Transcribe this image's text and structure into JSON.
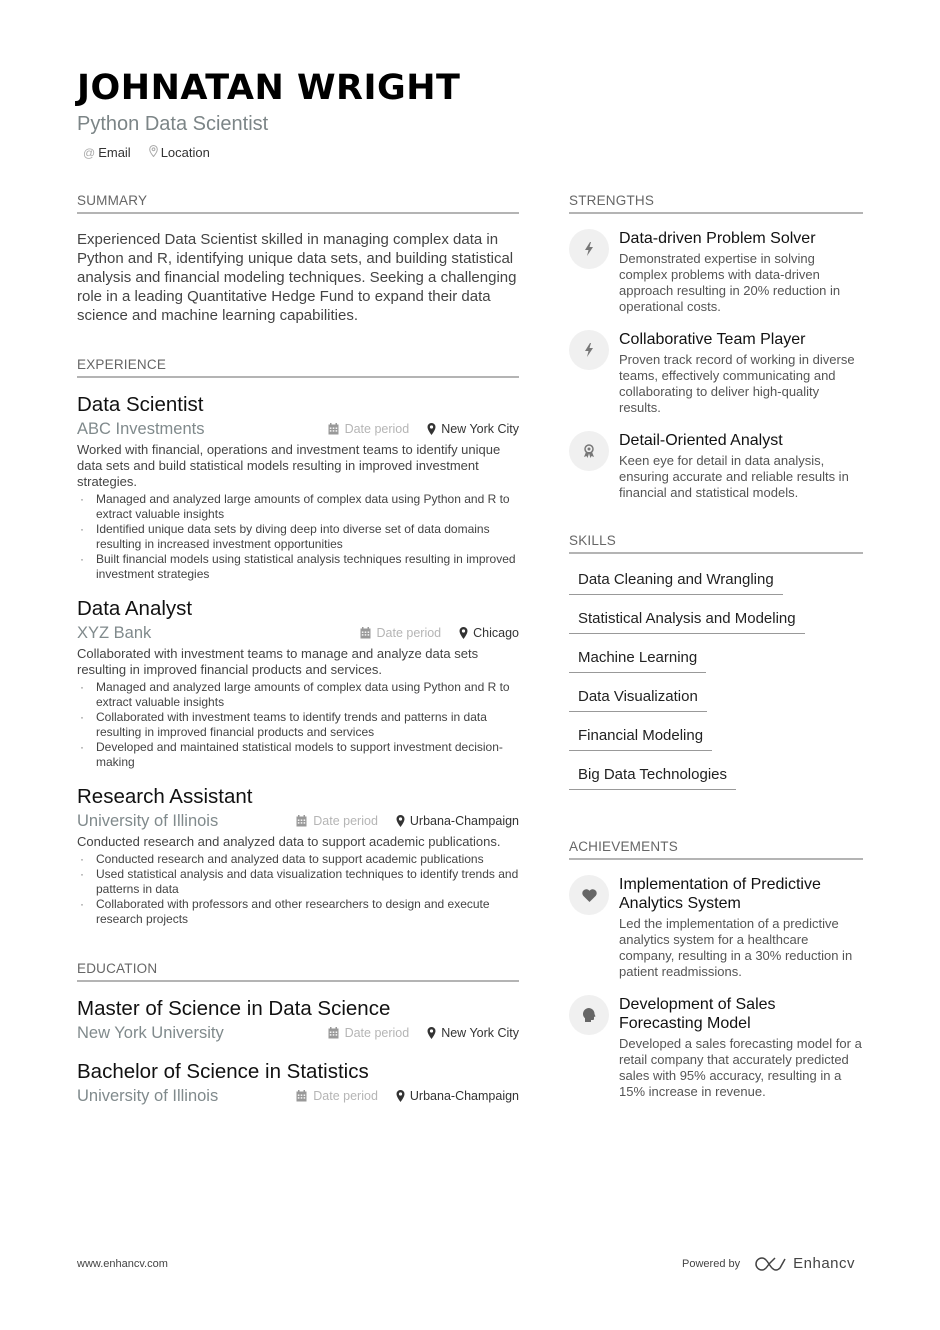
{
  "header": {
    "name": "JOHNATAN WRIGHT",
    "title": "Python Data Scientist",
    "contacts": [
      {
        "icon": "at-icon",
        "label": "Email"
      },
      {
        "icon": "location-pin-icon",
        "label": "Location"
      }
    ]
  },
  "summary": {
    "heading": "SUMMARY",
    "text": "Experienced Data Scientist skilled in managing complex data in Python and R, identifying unique data sets, and building statistical analysis and financial modeling techniques. Seeking a challenging role in a leading Quantitative Hedge Fund to expand their data science and machine learning capabilities."
  },
  "experience": {
    "heading": "EXPERIENCE",
    "items": [
      {
        "role": "Data Scientist",
        "company": "ABC Investments",
        "date": "Date period",
        "location": "New York City",
        "description": "Worked with financial, operations and investment teams to identify unique data sets and build statistical models resulting in improved investment strategies.",
        "bullets": [
          "Managed and analyzed large amounts of complex data using Python and R to extract valuable insights",
          "Identified unique data sets by diving deep into diverse set of data domains resulting in increased investment opportunities",
          "Built financial models using statistical analysis techniques resulting in improved investment strategies"
        ]
      },
      {
        "role": "Data Analyst",
        "company": "XYZ Bank",
        "date": "Date period",
        "location": "Chicago",
        "description": "Collaborated with investment teams to manage and analyze data sets resulting in improved financial products and services.",
        "bullets": [
          "Managed and analyzed large amounts of complex data using Python and R to extract valuable insights",
          "Collaborated with investment teams to identify trends and patterns in data resulting in improved financial products and services",
          "Developed and maintained statistical models to support investment decision-making"
        ]
      },
      {
        "role": "Research Assistant",
        "company": "University of Illinois",
        "date": "Date period",
        "location": "Urbana-Champaign",
        "description": "Conducted research and analyzed data to support academic publications.",
        "bullets": [
          "Conducted research and analyzed data to support academic publications",
          "Used statistical analysis and data visualization techniques to identify trends and patterns in data",
          "Collaborated with professors and other researchers to design and execute research projects"
        ]
      }
    ]
  },
  "education": {
    "heading": "EDUCATION",
    "items": [
      {
        "degree": "Master of Science in Data Science",
        "school": "New York University",
        "date": "Date period",
        "location": "New York City"
      },
      {
        "degree": "Bachelor of Science in Statistics",
        "school": "University of Illinois",
        "date": "Date period",
        "location": "Urbana-Champaign"
      }
    ]
  },
  "strengths": {
    "heading": "STRENGTHS",
    "items": [
      {
        "icon": "lightning-bolt-icon",
        "title": "Data-driven Problem Solver",
        "description": "Demonstrated expertise in solving complex problems with data-driven approach resulting in 20% reduction in operational costs."
      },
      {
        "icon": "lightning-bolt-icon",
        "title": "Collaborative Team Player",
        "description": "Proven track record of working in diverse teams, effectively communicating and collaborating to deliver high-quality results."
      },
      {
        "icon": "award-ribbon-icon",
        "title": "Detail-Oriented Analyst",
        "description": "Keen eye for detail in data analysis, ensuring accurate and reliable results in financial and statistical models."
      }
    ]
  },
  "skills": {
    "heading": "SKILLS",
    "items": [
      "Data Cleaning and Wrangling",
      "Statistical Analysis and Modeling",
      "Machine Learning",
      "Data Visualization",
      "Financial Modeling",
      "Big Data Technologies"
    ]
  },
  "achievements": {
    "heading": "ACHIEVEMENTS",
    "items": [
      {
        "icon": "heart-icon",
        "title": "Implementation of Predictive Analytics System",
        "description": "Led the implementation of a predictive analytics system for a healthcare company, resulting in a 30% reduction in patient readmissions."
      },
      {
        "icon": "brain-head-icon",
        "title": "Development of Sales Forecasting Model",
        "description": "Developed a sales forecasting model for a retail company that accurately predicted sales with 95% accuracy, resulting in a 15% increase in revenue."
      }
    ]
  },
  "footer": {
    "website": "www.enhancv.com",
    "powered_by": "Powered by",
    "brand": "Enhancv"
  }
}
